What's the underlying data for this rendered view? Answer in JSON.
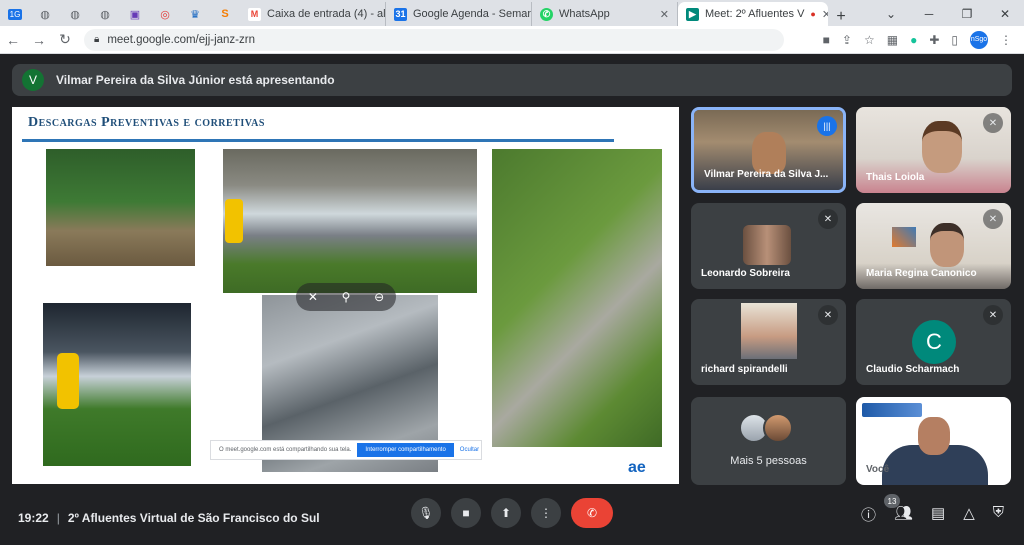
{
  "browser": {
    "pinned_tabs": [
      "1G",
      "",
      "",
      "",
      "",
      "",
      "",
      "S"
    ],
    "tabs": [
      {
        "label": "Caixa de entrada (4) - al",
        "icon": "gmail-icon",
        "color": "#ea4335"
      },
      {
        "label": "Google Agenda - Seman",
        "icon": "calendar-icon",
        "color": "#1a73e8"
      },
      {
        "label": "WhatsApp",
        "icon": "whatsapp-icon",
        "color": "#25d366"
      },
      {
        "label": "Meet: 2º Afluentes V",
        "icon": "meet-icon",
        "color": "#00897b",
        "active": true
      }
    ],
    "url": "meet.google.com/ejj-janz-zrn",
    "profile": "nSgo"
  },
  "meet": {
    "presenting_initial": "V",
    "presenting_text": "Vilmar Pereira da Silva Júnior está apresentando",
    "slide": {
      "title": "Descargas Preventivas e corretivas",
      "share_notice": "O meet.google.com está compartilhando sua tela.",
      "stop_share": "Interromper compartilhamento",
      "hide": "Ocultar",
      "logo": "ae"
    },
    "participants": [
      {
        "name": "Vilmar Pereira da Silva J...",
        "speaking": true
      },
      {
        "name": "Thais Loiola"
      },
      {
        "name": "Leonardo Sobreira"
      },
      {
        "name": "Maria Regina Canonico"
      },
      {
        "name": "richard spirandelli"
      },
      {
        "name": "Claudio Scharmach",
        "initial": "C"
      },
      {
        "name": "Mais 5 pessoas"
      },
      {
        "name": "Você"
      }
    ],
    "clock": "19:22",
    "meeting_title": "2º Afluentes Virtual de São Francisco do Sul",
    "people_count": "13"
  }
}
